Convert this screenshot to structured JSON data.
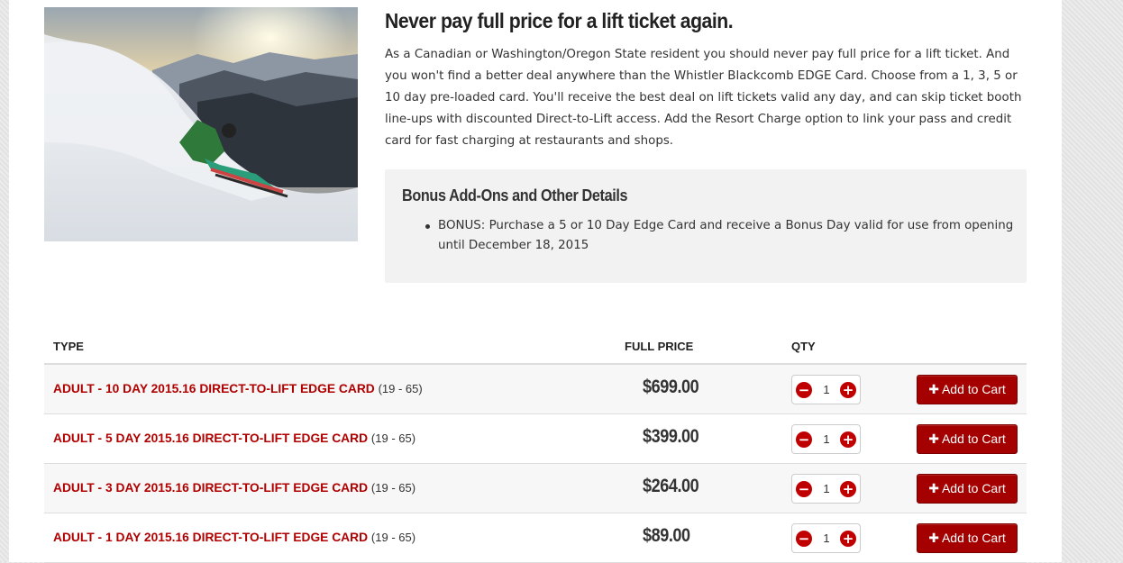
{
  "hero": {
    "headline": "Never pay full price for a lift ticket again.",
    "intro": "As a Canadian or Washington/Oregon State resident you should never pay full price for a lift ticket. And you won't find a better deal anywhere than the Whistler Blackcomb EDGE Card. Choose from a 1, 3, 5 or 10 day pre-loaded card. You'll receive the best deal on lift tickets valid any day, and can skip ticket booth line-ups with discounted Direct-to-Lift access. Add the Resort Charge option to link your pass and credit card for fast charging at restaurants and shops."
  },
  "addons": {
    "title": "Bonus Add-Ons and Other Details",
    "items": [
      "BONUS: Purchase a 5 or 10 Day Edge Card and receive a Bonus Day valid for use from opening until December 18, 2015"
    ]
  },
  "table": {
    "headers": {
      "type": "TYPE",
      "price": "FULL PRICE",
      "qty": "QTY"
    },
    "rows": [
      {
        "name": "ADULT - 10 DAY 2015.16 DIRECT-TO-LIFT EDGE CARD",
        "age": "(19 - 65)",
        "price": "$699.00",
        "qty": "1",
        "button": "Add to Cart"
      },
      {
        "name": "ADULT - 5 DAY 2015.16 DIRECT-TO-LIFT EDGE CARD",
        "age": "(19 - 65)",
        "price": "$399.00",
        "qty": "1",
        "button": "Add to Cart"
      },
      {
        "name": "ADULT - 3 DAY 2015.16 DIRECT-TO-LIFT EDGE CARD",
        "age": "(19 - 65)",
        "price": "$264.00",
        "qty": "1",
        "button": "Add to Cart"
      },
      {
        "name": "ADULT - 1 DAY 2015.16 DIRECT-TO-LIFT EDGE CARD",
        "age": "(19 - 65)",
        "price": "$89.00",
        "qty": "1",
        "button": "Add to Cart"
      }
    ]
  },
  "icons": {
    "minus": "minus-circle-icon",
    "plus": "plus-circle-icon",
    "cart_plus": "plus-icon"
  },
  "colors": {
    "accent": "#b00000",
    "button": "#a50000",
    "addon_bg": "#f2f2f2"
  }
}
